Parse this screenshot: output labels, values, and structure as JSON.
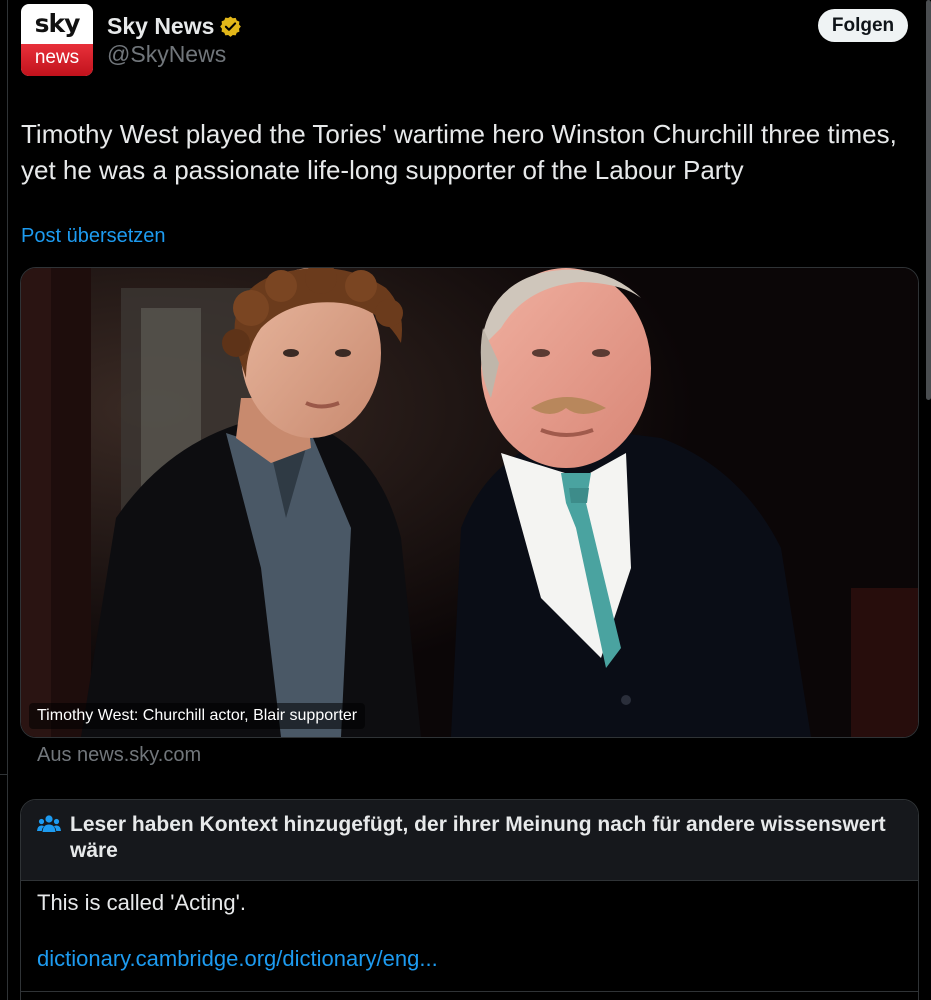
{
  "account": {
    "avatar_top": "sky",
    "avatar_bottom": "news",
    "display_name": "Sky News",
    "handle": "@SkyNews",
    "follow_label": "Folgen"
  },
  "post": {
    "text": "Timothy West played the Tories' wartime hero Winston Churchill three times, yet he was a passionate life-long supporter of the Labour Party",
    "translate_label": "Post übersetzen"
  },
  "card": {
    "caption": "Timothy West: Churchill actor, Blair supporter",
    "source": "Aus news.sky.com"
  },
  "community_note": {
    "title": "Leser haben Kontext hinzugefügt, der ihrer Meinung nach für andere wissenswert wäre",
    "body": "This is called 'Acting'.",
    "link": "dictionary.cambridge.org/dictionary/eng..."
  },
  "colors": {
    "background": "#000000",
    "link": "#1d9bf0",
    "verified_gold": "#e2b719",
    "secondary_text": "#71767b"
  }
}
